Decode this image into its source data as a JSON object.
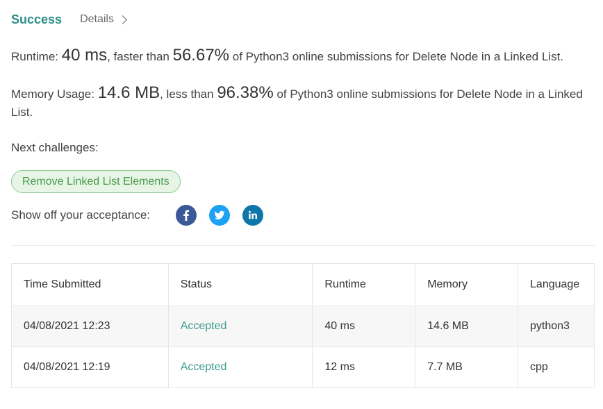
{
  "header": {
    "status_label": "Success",
    "details_label": "Details"
  },
  "runtime": {
    "prefix": "Runtime: ",
    "value": "40 ms",
    "middle": ", faster than ",
    "percent": "56.67%",
    "suffix": " of Python3 online submissions for Delete Node in a Linked List."
  },
  "memory": {
    "prefix": "Memory Usage: ",
    "value": "14.6 MB",
    "middle": ", less than ",
    "percent": "96.38%",
    "suffix": " of Python3 online submissions for Delete Node in a Linked List."
  },
  "next": {
    "label": "Next challenges:",
    "challenges": [
      "Remove Linked List Elements"
    ]
  },
  "share": {
    "label": "Show off your acceptance:",
    "icons": [
      "facebook-icon",
      "twitter-icon",
      "linkedin-icon"
    ]
  },
  "table": {
    "headers": [
      "Time Submitted",
      "Status",
      "Runtime",
      "Memory",
      "Language"
    ],
    "rows": [
      {
        "time": "04/08/2021 12:23",
        "status": "Accepted",
        "runtime": "40 ms",
        "memory": "14.6 MB",
        "language": "python3"
      },
      {
        "time": "04/08/2021 12:19",
        "status": "Accepted",
        "runtime": "12 ms",
        "memory": "7.7 MB",
        "language": "cpp"
      }
    ]
  },
  "colors": {
    "success": "#2d8f8a",
    "accepted": "#3c9a8f",
    "pill_bg": "#e7f5e7",
    "pill_border": "#8ec98e",
    "facebook": "#3b5998",
    "twitter": "#1da1f2",
    "linkedin": "#0e76a8"
  }
}
